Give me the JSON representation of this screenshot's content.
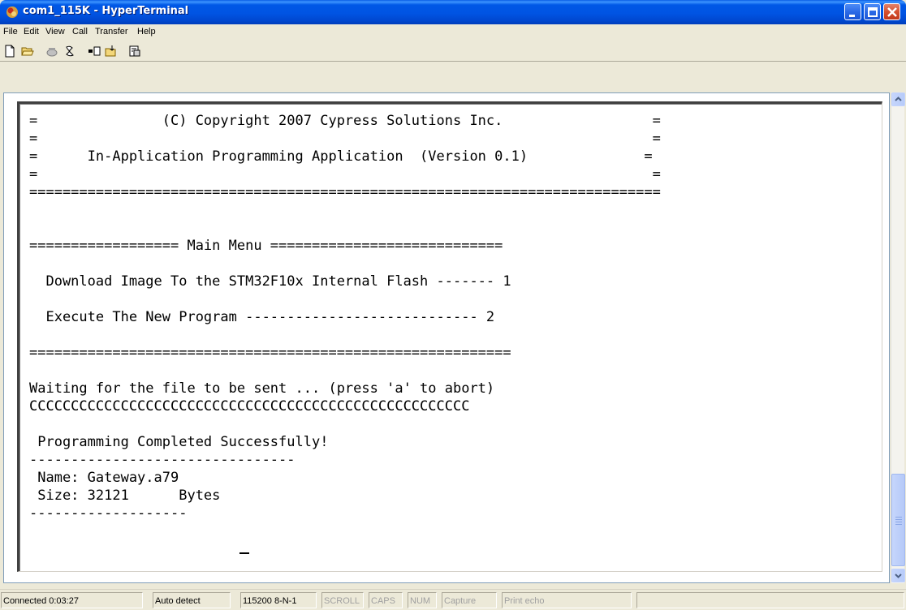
{
  "window": {
    "title": "com1_115K - HyperTerminal"
  },
  "menu": {
    "items": [
      "File",
      "Edit",
      "View",
      "Call",
      "Transfer",
      "Help"
    ]
  },
  "toolbar": {
    "icons": [
      "new-icon",
      "open-icon",
      "call-icon",
      "disconnect-icon",
      "send-icon",
      "receive-icon",
      "properties-icon"
    ]
  },
  "terminal": {
    "lines": [
      "=               (C) Copyright 2007 Cypress Solutions Inc.                  =",
      "=                                                                          =",
      "=      In-Application Programming Application  (Version 0.1)              =",
      "=                                                                          =",
      "============================================================================",
      "",
      "",
      "================== Main Menu ============================",
      "",
      "  Download Image To the STM32F10x Internal Flash ------- 1",
      "",
      "  Execute The New Program ---------------------------- 2",
      "",
      "==========================================================",
      "",
      "Waiting for the file to be sent ... (press 'a' to abort)",
      "CCCCCCCCCCCCCCCCCCCCCCCCCCCCCCCCCCCCCCCCCCCCCCCCCCCCC",
      "",
      " Programming Completed Successfully!",
      "--------------------------------",
      " Name: Gateway.a79",
      " Size: 32121      Bytes",
      "-------------------"
    ]
  },
  "status": {
    "connected": "Connected 0:03:27",
    "detect": "Auto detect",
    "settings": "115200 8-N-1",
    "scroll": "SCROLL",
    "caps": "CAPS",
    "num": "NUM",
    "capture": "Capture",
    "print_echo": "Print echo"
  },
  "colors": {
    "titlebar": "#0054e3",
    "terminal_bg": "#ffffff",
    "text": "#000000"
  }
}
